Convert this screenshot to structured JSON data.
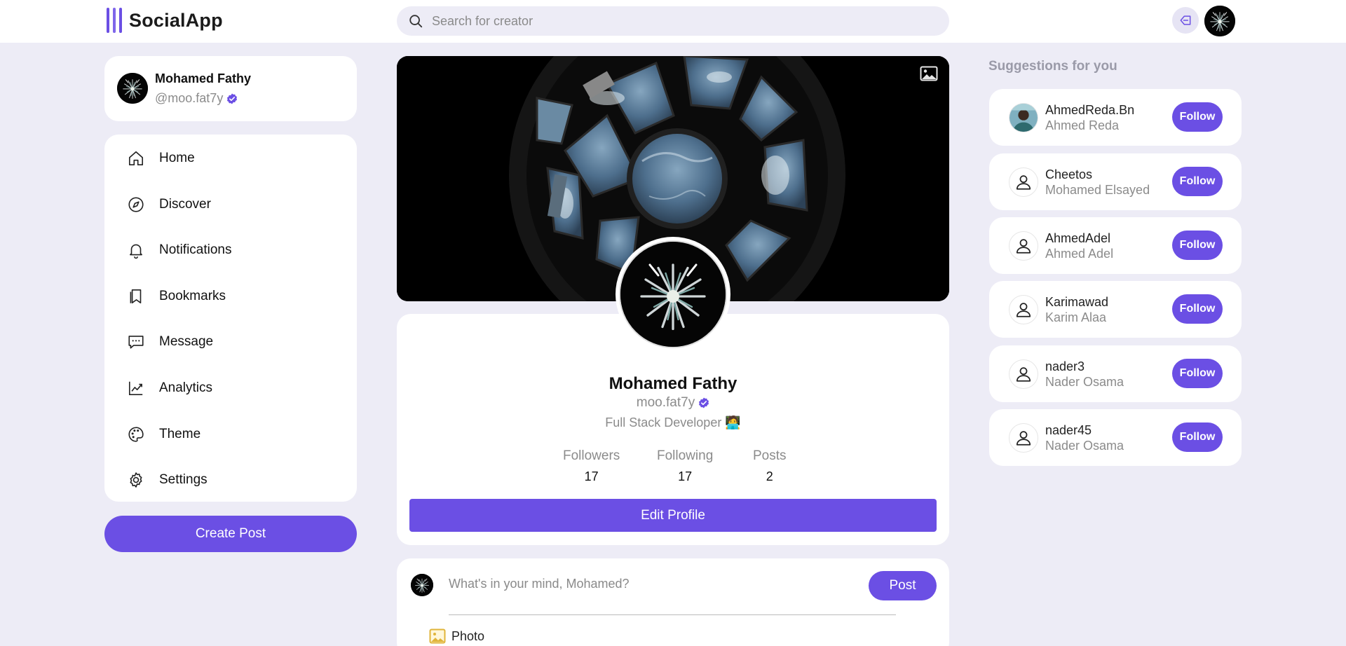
{
  "app": {
    "name": "SocialApp",
    "accent": "#6b4fe4",
    "background": "#edecf6"
  },
  "header": {
    "search_placeholder": "Search for creator"
  },
  "sidebar": {
    "user": {
      "name": "Mohamed Fathy",
      "handle": "@moo.fat7y"
    },
    "nav": [
      {
        "label": "Home",
        "icon": "home-icon"
      },
      {
        "label": "Discover",
        "icon": "compass-icon"
      },
      {
        "label": "Notifications",
        "icon": "bell-icon"
      },
      {
        "label": "Bookmarks",
        "icon": "bookmark-icon"
      },
      {
        "label": "Message",
        "icon": "message-icon"
      },
      {
        "label": "Analytics",
        "icon": "chart-icon"
      },
      {
        "label": "Theme",
        "icon": "palette-icon"
      },
      {
        "label": "Settings",
        "icon": "gear-icon"
      }
    ],
    "create_post_label": "Create Post"
  },
  "profile": {
    "name": "Mohamed Fathy",
    "handle": "moo.fat7y",
    "bio": "Full Stack Developer 🧑‍💻",
    "stats": [
      {
        "label": "Followers",
        "value": "17"
      },
      {
        "label": "Following",
        "value": "17"
      },
      {
        "label": "Posts",
        "value": "2"
      }
    ],
    "edit_label": "Edit Profile"
  },
  "composer": {
    "placeholder": "What's in your mind, Mohamed?",
    "post_label": "Post",
    "photo_label": "Photo"
  },
  "suggestions": {
    "title": "Suggestions for you",
    "follow_label": "Follow",
    "items": [
      {
        "username": "AhmedReda.Bn",
        "name": "Ahmed Reda",
        "has_photo": true
      },
      {
        "username": "Cheetos",
        "name": "Mohamed Elsayed",
        "has_photo": false
      },
      {
        "username": "AhmedAdel",
        "name": "Ahmed Adel",
        "has_photo": false
      },
      {
        "username": "Karimawad",
        "name": "Karim Alaa",
        "has_photo": false
      },
      {
        "username": "nader3",
        "name": "Nader Osama",
        "has_photo": false
      },
      {
        "username": "nader45",
        "name": "Nader Osama",
        "has_photo": false
      }
    ]
  }
}
